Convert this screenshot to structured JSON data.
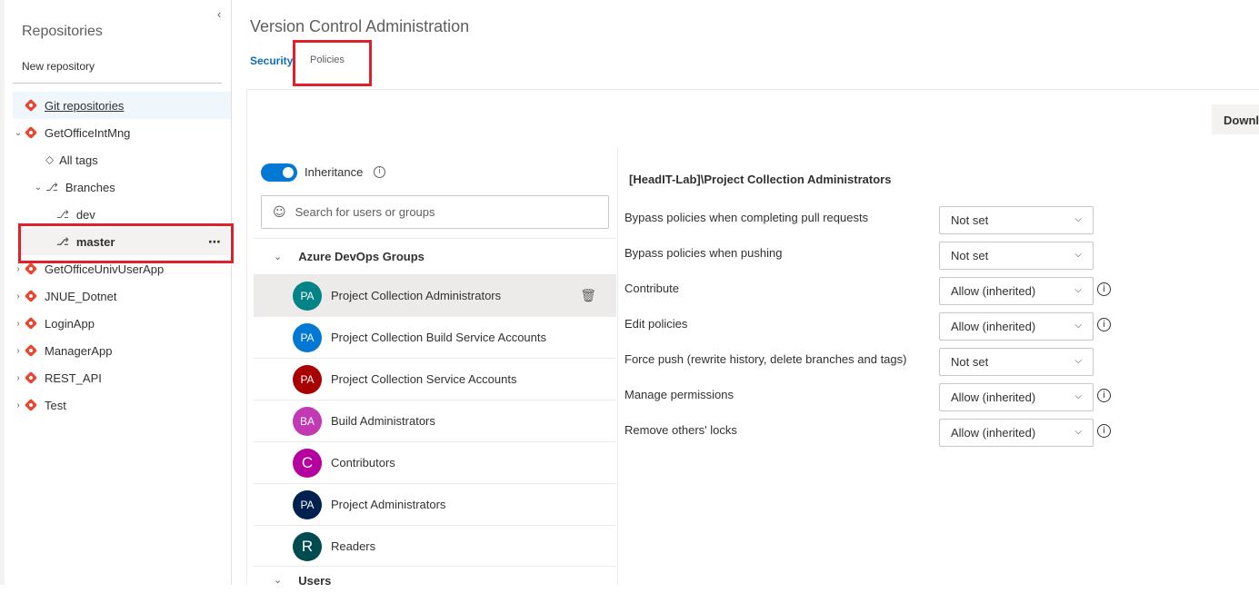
{
  "sidebar": {
    "title": "Repositories",
    "new_repo": "New repository",
    "collapse_icon": "‹",
    "git_repos": "Git repositories",
    "repo_main": "GetOfficeIntMng",
    "all_tags": "All tags",
    "branches": "Branches",
    "branch_dev": "dev",
    "branch_master": "master",
    "more": "⋯",
    "repos": [
      "GetOfficeUnivUserApp",
      "JNUE_Dotnet",
      "LoginApp",
      "ManagerApp",
      "REST_API",
      "Test"
    ]
  },
  "header": {
    "title": "Version Control Administration",
    "tabs": [
      "Security",
      "Policies"
    ]
  },
  "download_label": "Downl",
  "inheritance": {
    "label": "Inheritance",
    "enabled": true
  },
  "search": {
    "placeholder": "Search for users or groups"
  },
  "groups": {
    "header": "Azure DevOps Groups",
    "items": [
      {
        "initials": "PA",
        "name": "Project Collection Administrators",
        "color": "#038387"
      },
      {
        "initials": "PA",
        "name": "Project Collection Build Service Accounts",
        "color": "#0078d4"
      },
      {
        "initials": "PA",
        "name": "Project Collection Service Accounts",
        "color": "#a80000"
      },
      {
        "initials": "BA",
        "name": "Build Administrators",
        "color": "#c239b3"
      },
      {
        "initials": "C",
        "name": "Contributors",
        "color": "#b4009e"
      },
      {
        "initials": "PA",
        "name": "Project Administrators",
        "color": "#002050"
      },
      {
        "initials": "R",
        "name": "Readers",
        "color": "#004b50"
      }
    ],
    "users_header": "Users"
  },
  "permissions": {
    "title": "[HeadIT-Lab]\\Project Collection Administrators",
    "items": [
      {
        "label": "Bypass policies when completing pull requests",
        "value": "Not set",
        "info": false
      },
      {
        "label": "Bypass policies when pushing",
        "value": "Not set",
        "info": false
      },
      {
        "label": "Contribute",
        "value": "Allow (inherited)",
        "info": true
      },
      {
        "label": "Edit policies",
        "value": "Allow (inherited)",
        "info": true
      },
      {
        "label": "Force push (rewrite history, delete branches and tags)",
        "value": "Not set",
        "info": false
      },
      {
        "label": "Manage permissions",
        "value": "Allow (inherited)",
        "info": true
      },
      {
        "label": "Remove others' locks",
        "value": "Allow (inherited)",
        "info": true
      }
    ]
  },
  "colors": {
    "accent": "#0078d4",
    "highlight": "#e0202a",
    "git": "#e8472f"
  }
}
